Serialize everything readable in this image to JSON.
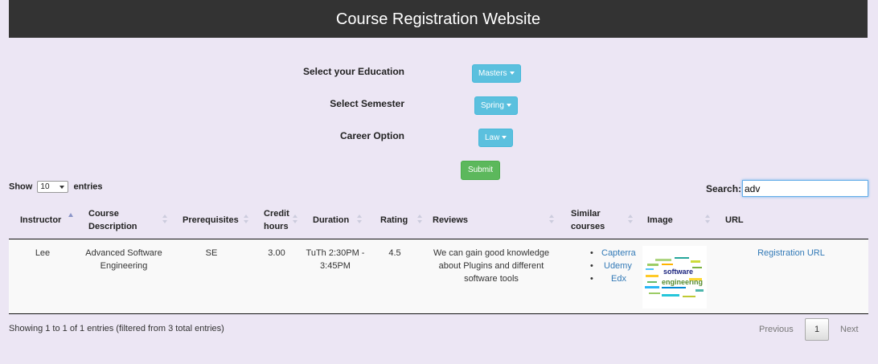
{
  "header": {
    "title": "Course Registration Website"
  },
  "form": {
    "education_label": "Select your Education",
    "education_value": "Masters",
    "semester_label": "Select Semester",
    "semester_value": "Spring",
    "career_label": "Career Option",
    "career_value": "Law",
    "submit_label": "Submit"
  },
  "table_controls": {
    "show_label": "Show",
    "entries_value": "10",
    "entries_label": "entries",
    "search_label": "Search:",
    "search_value": "adv"
  },
  "columns": [
    "Instructor",
    "Course Description",
    "Prerequisites",
    "Credit hours",
    "Duration",
    "Rating",
    "Reviews",
    "Similar courses",
    "Image",
    "URL"
  ],
  "rows": [
    {
      "instructor": "Lee",
      "description": "Advanced Software Engineering",
      "prerequisites": "SE",
      "credit_hours": "3.00",
      "duration": "TuTh 2:30PM - 3:45PM",
      "rating": "4.5",
      "reviews": "We can gain good knowledge about Plugins and different software tools",
      "similar": [
        "Capterra",
        "Udemy",
        "Edx"
      ],
      "image_text": [
        "software",
        "engineering"
      ],
      "url_label": "Registration URL"
    }
  ],
  "footer": {
    "info": "Showing 1 to 1 of 1 entries (filtered from 3 total entries)",
    "previous": "Previous",
    "page": "1",
    "next": "Next"
  },
  "colors": {
    "background": "#ece6f4",
    "header": "#333333",
    "dropdown": "#5bc0de",
    "submit": "#5cb85c",
    "link": "#337ab7"
  }
}
